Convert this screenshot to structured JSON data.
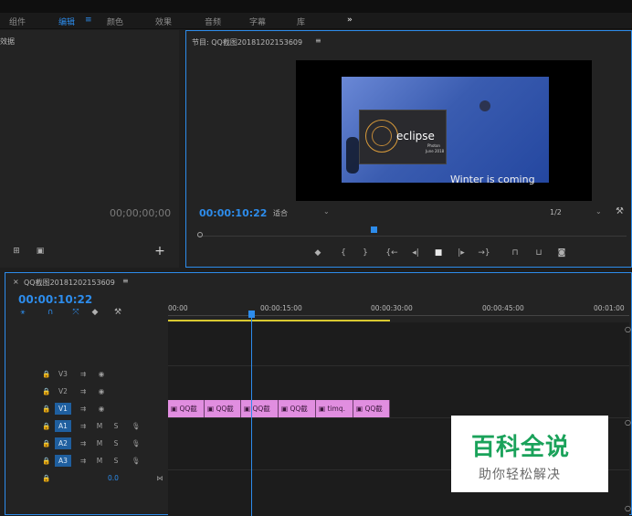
{
  "workspaces": [
    {
      "label": "组件",
      "active": false
    },
    {
      "label": "编辑",
      "active": true
    },
    {
      "label": "颜色",
      "active": false
    },
    {
      "label": "效果",
      "active": false
    },
    {
      "label": "音频",
      "active": false
    },
    {
      "label": "字幕",
      "active": false
    },
    {
      "label": "库",
      "active": false
    },
    {
      "label": "»",
      "active": false
    }
  ],
  "source_panel": {
    "title": "效据",
    "timecode": "00;00;00;00"
  },
  "program": {
    "title": "节目: QQ截图20181202153609",
    "timecode": "00:00:10:22",
    "fit": "适合",
    "resolution": "1/2",
    "video": {
      "logo": "eclipse",
      "tagline": "Photon",
      "date": "June 2018",
      "caption": "Winter is coming"
    }
  },
  "sequence": {
    "tab": "QQ截图20181202153609",
    "timecode": "00:00:10:22",
    "ruler": [
      "00:00",
      "00:00:15:00",
      "00:00:30:00",
      "00:00:45:00",
      "00:01:00"
    ],
    "video_tracks": [
      "V3",
      "V2",
      "V1"
    ],
    "audio_tracks": [
      "A1",
      "A2",
      "A3"
    ],
    "track_flags": [
      "M",
      "S"
    ],
    "master_level": "0.0",
    "clips": [
      "QQ截",
      "QQ截",
      "QQ截",
      "QQ截",
      "timq.",
      "QQ截"
    ]
  },
  "watermark": {
    "title": "百科全说",
    "subtitle": "助你轻松解决"
  },
  "icons": {
    "menu": "hamburger-icon",
    "wrench": "wrench-icon",
    "camera": "camera-icon",
    "add": "plus-icon"
  }
}
